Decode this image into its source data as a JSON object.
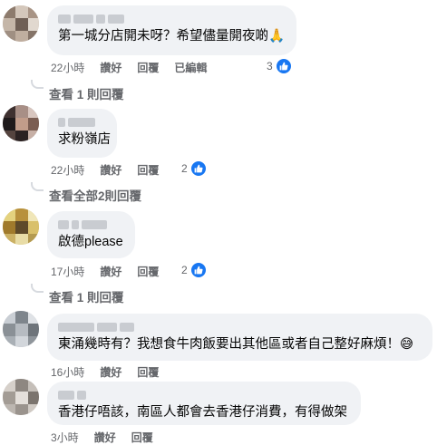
{
  "comments": [
    {
      "text": "第一城分店開未呀？希望儘量開夜啲🙏",
      "time": "22小時",
      "like": "讚好",
      "reply": "回覆",
      "edited": "已編輯",
      "reaction_count": "3",
      "view_replies": "查看 1 則回覆"
    },
    {
      "text": "求粉嶺店",
      "time": "22小時",
      "like": "讚好",
      "reply": "回覆",
      "reaction_count": "2",
      "view_replies": "查看全部2則回覆"
    },
    {
      "text": "啟德please",
      "time": "17小時",
      "like": "讚好",
      "reply": "回覆",
      "reaction_count": "2",
      "view_replies": "查看 1 則回覆"
    },
    {
      "text": "東涌幾時有？我想食牛肉飯要出其他區或者自己整好麻煩！😅",
      "time": "16小時",
      "like": "讚好",
      "reply": "回覆"
    },
    {
      "text": "香港仔唔該，南區人都會去香港仔消費，有得做架",
      "time": "3小時",
      "like": "讚好",
      "reply": "回覆"
    }
  ],
  "colors": {
    "bubble": "#f0f2f5",
    "meta_text": "#65676b",
    "like_blue": "#1877f2"
  },
  "icons": {
    "like_reaction": "thumbs-up-icon"
  }
}
